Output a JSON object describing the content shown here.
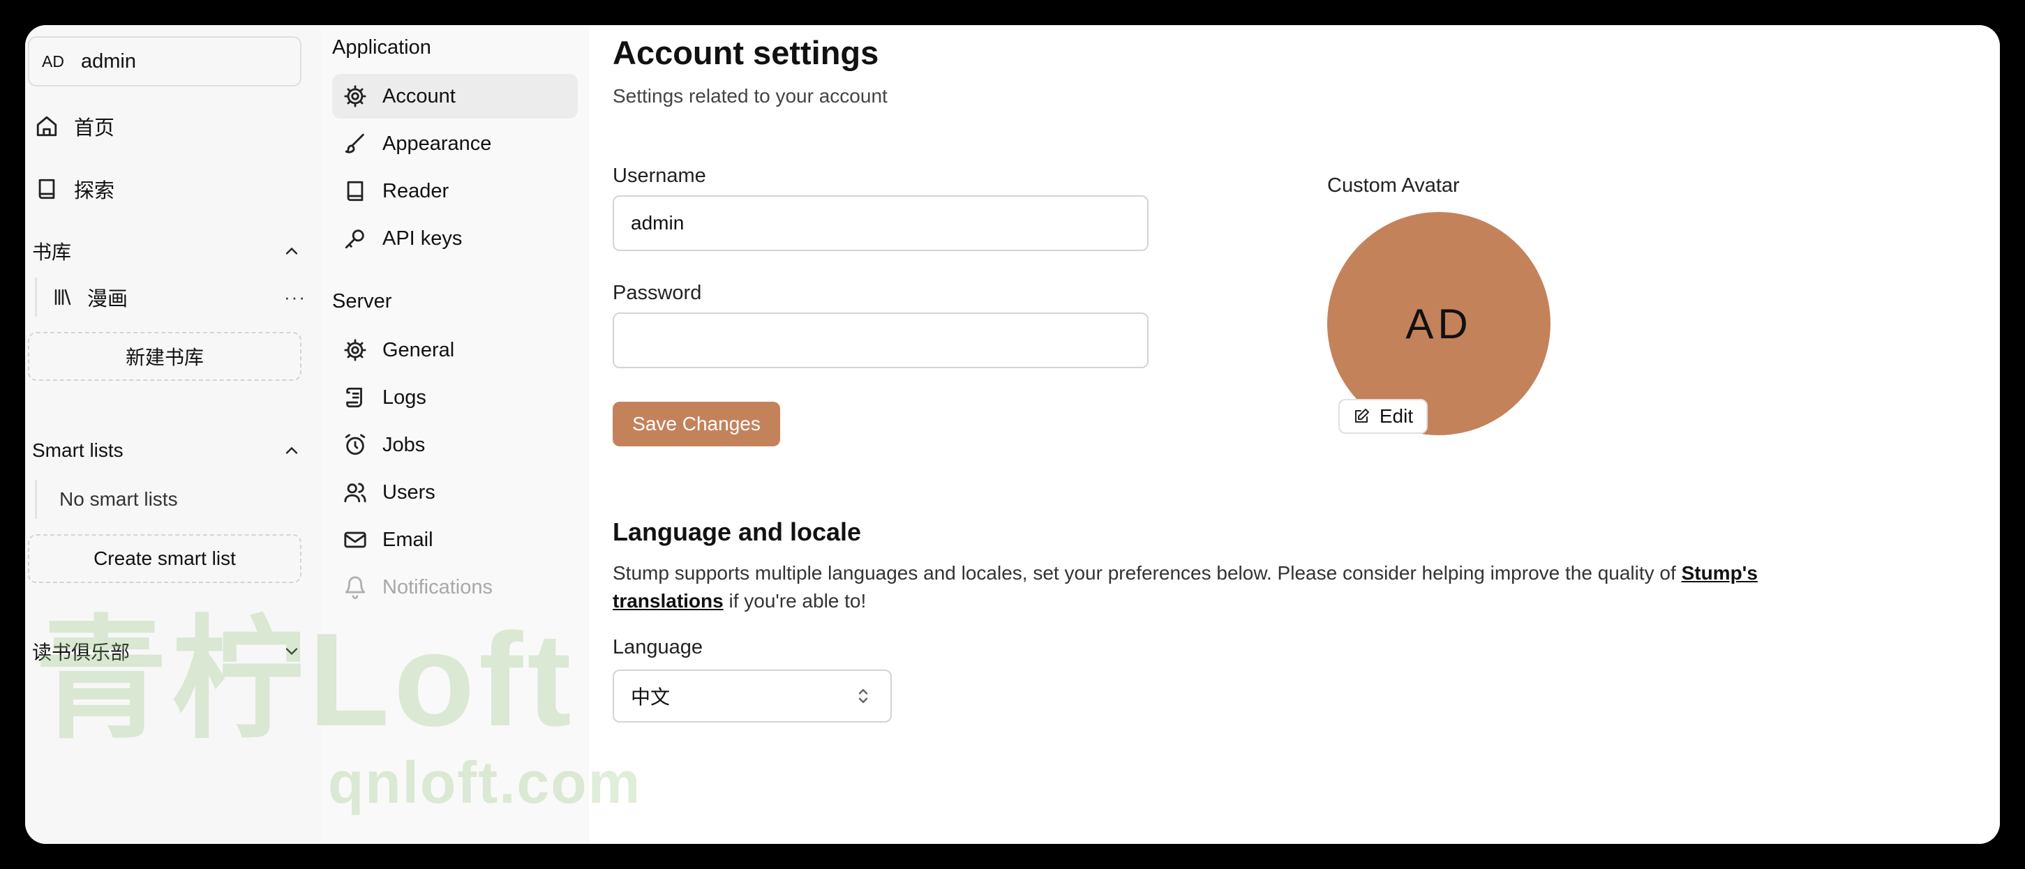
{
  "sidebar": {
    "user": {
      "initials": "AD",
      "name": "admin"
    },
    "nav": [
      {
        "label": "首页",
        "icon": "home-icon"
      },
      {
        "label": "探索",
        "icon": "book-icon"
      }
    ],
    "libraries": {
      "title": "书库",
      "items": [
        {
          "label": "漫画",
          "icon": "library-icon"
        }
      ],
      "more_label": "···",
      "new_label": "新建书库"
    },
    "smart_lists": {
      "title": "Smart lists",
      "empty_label": "No smart lists",
      "create_label": "Create smart list"
    },
    "book_clubs": {
      "title": "读书俱乐部"
    }
  },
  "settings_nav": {
    "application": {
      "title": "Application",
      "items": [
        {
          "label": "Account",
          "icon": "gear-icon",
          "active": true
        },
        {
          "label": "Appearance",
          "icon": "brush-icon"
        },
        {
          "label": "Reader",
          "icon": "book-icon"
        },
        {
          "label": "API keys",
          "icon": "key-icon"
        }
      ]
    },
    "server": {
      "title": "Server",
      "items": [
        {
          "label": "General",
          "icon": "gear-icon"
        },
        {
          "label": "Logs",
          "icon": "scroll-icon"
        },
        {
          "label": "Jobs",
          "icon": "alarm-clock-icon"
        },
        {
          "label": "Users",
          "icon": "users-icon"
        },
        {
          "label": "Email",
          "icon": "mail-icon"
        },
        {
          "label": "Notifications",
          "icon": "bell-icon",
          "disabled": true
        }
      ]
    }
  },
  "main": {
    "title": "Account settings",
    "subtitle": "Settings related to your account",
    "username": {
      "label": "Username",
      "value": "admin"
    },
    "password": {
      "label": "Password",
      "value": ""
    },
    "save_label": "Save Changes",
    "avatar": {
      "label": "Custom Avatar",
      "initials": "AD",
      "edit_label": "Edit"
    },
    "language_section": {
      "title": "Language and locale",
      "description_before": "Stump supports multiple languages and locales, set your preferences below. Please consider helping improve the quality of ",
      "link_text": "Stump's translations",
      "description_after": " if you're able to!",
      "language_label": "Language",
      "language_value": "中文"
    }
  },
  "watermark": {
    "logo_text": "青柠Loft",
    "url": "qnloft.com"
  },
  "colors": {
    "accent": "#c4825b",
    "sidebar_bg": "#f7f7f7",
    "active_bg": "#ececec"
  }
}
